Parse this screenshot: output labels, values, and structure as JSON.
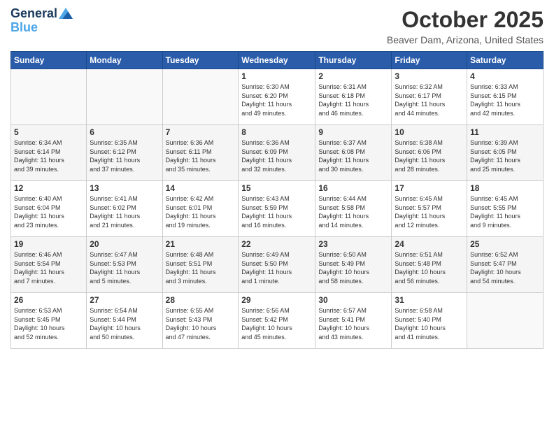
{
  "header": {
    "logo_line1": "General",
    "logo_line2": "Blue",
    "month_title": "October 2025",
    "location": "Beaver Dam, Arizona, United States"
  },
  "weekdays": [
    "Sunday",
    "Monday",
    "Tuesday",
    "Wednesday",
    "Thursday",
    "Friday",
    "Saturday"
  ],
  "weeks": [
    [
      {
        "day": "",
        "info": ""
      },
      {
        "day": "",
        "info": ""
      },
      {
        "day": "",
        "info": ""
      },
      {
        "day": "1",
        "info": "Sunrise: 6:30 AM\nSunset: 6:20 PM\nDaylight: 11 hours\nand 49 minutes."
      },
      {
        "day": "2",
        "info": "Sunrise: 6:31 AM\nSunset: 6:18 PM\nDaylight: 11 hours\nand 46 minutes."
      },
      {
        "day": "3",
        "info": "Sunrise: 6:32 AM\nSunset: 6:17 PM\nDaylight: 11 hours\nand 44 minutes."
      },
      {
        "day": "4",
        "info": "Sunrise: 6:33 AM\nSunset: 6:15 PM\nDaylight: 11 hours\nand 42 minutes."
      }
    ],
    [
      {
        "day": "5",
        "info": "Sunrise: 6:34 AM\nSunset: 6:14 PM\nDaylight: 11 hours\nand 39 minutes."
      },
      {
        "day": "6",
        "info": "Sunrise: 6:35 AM\nSunset: 6:12 PM\nDaylight: 11 hours\nand 37 minutes."
      },
      {
        "day": "7",
        "info": "Sunrise: 6:36 AM\nSunset: 6:11 PM\nDaylight: 11 hours\nand 35 minutes."
      },
      {
        "day": "8",
        "info": "Sunrise: 6:36 AM\nSunset: 6:09 PM\nDaylight: 11 hours\nand 32 minutes."
      },
      {
        "day": "9",
        "info": "Sunrise: 6:37 AM\nSunset: 6:08 PM\nDaylight: 11 hours\nand 30 minutes."
      },
      {
        "day": "10",
        "info": "Sunrise: 6:38 AM\nSunset: 6:06 PM\nDaylight: 11 hours\nand 28 minutes."
      },
      {
        "day": "11",
        "info": "Sunrise: 6:39 AM\nSunset: 6:05 PM\nDaylight: 11 hours\nand 25 minutes."
      }
    ],
    [
      {
        "day": "12",
        "info": "Sunrise: 6:40 AM\nSunset: 6:04 PM\nDaylight: 11 hours\nand 23 minutes."
      },
      {
        "day": "13",
        "info": "Sunrise: 6:41 AM\nSunset: 6:02 PM\nDaylight: 11 hours\nand 21 minutes."
      },
      {
        "day": "14",
        "info": "Sunrise: 6:42 AM\nSunset: 6:01 PM\nDaylight: 11 hours\nand 19 minutes."
      },
      {
        "day": "15",
        "info": "Sunrise: 6:43 AM\nSunset: 5:59 PM\nDaylight: 11 hours\nand 16 minutes."
      },
      {
        "day": "16",
        "info": "Sunrise: 6:44 AM\nSunset: 5:58 PM\nDaylight: 11 hours\nand 14 minutes."
      },
      {
        "day": "17",
        "info": "Sunrise: 6:45 AM\nSunset: 5:57 PM\nDaylight: 11 hours\nand 12 minutes."
      },
      {
        "day": "18",
        "info": "Sunrise: 6:45 AM\nSunset: 5:55 PM\nDaylight: 11 hours\nand 9 minutes."
      }
    ],
    [
      {
        "day": "19",
        "info": "Sunrise: 6:46 AM\nSunset: 5:54 PM\nDaylight: 11 hours\nand 7 minutes."
      },
      {
        "day": "20",
        "info": "Sunrise: 6:47 AM\nSunset: 5:53 PM\nDaylight: 11 hours\nand 5 minutes."
      },
      {
        "day": "21",
        "info": "Sunrise: 6:48 AM\nSunset: 5:51 PM\nDaylight: 11 hours\nand 3 minutes."
      },
      {
        "day": "22",
        "info": "Sunrise: 6:49 AM\nSunset: 5:50 PM\nDaylight: 11 hours\nand 1 minute."
      },
      {
        "day": "23",
        "info": "Sunrise: 6:50 AM\nSunset: 5:49 PM\nDaylight: 10 hours\nand 58 minutes."
      },
      {
        "day": "24",
        "info": "Sunrise: 6:51 AM\nSunset: 5:48 PM\nDaylight: 10 hours\nand 56 minutes."
      },
      {
        "day": "25",
        "info": "Sunrise: 6:52 AM\nSunset: 5:47 PM\nDaylight: 10 hours\nand 54 minutes."
      }
    ],
    [
      {
        "day": "26",
        "info": "Sunrise: 6:53 AM\nSunset: 5:45 PM\nDaylight: 10 hours\nand 52 minutes."
      },
      {
        "day": "27",
        "info": "Sunrise: 6:54 AM\nSunset: 5:44 PM\nDaylight: 10 hours\nand 50 minutes."
      },
      {
        "day": "28",
        "info": "Sunrise: 6:55 AM\nSunset: 5:43 PM\nDaylight: 10 hours\nand 47 minutes."
      },
      {
        "day": "29",
        "info": "Sunrise: 6:56 AM\nSunset: 5:42 PM\nDaylight: 10 hours\nand 45 minutes."
      },
      {
        "day": "30",
        "info": "Sunrise: 6:57 AM\nSunset: 5:41 PM\nDaylight: 10 hours\nand 43 minutes."
      },
      {
        "day": "31",
        "info": "Sunrise: 6:58 AM\nSunset: 5:40 PM\nDaylight: 10 hours\nand 41 minutes."
      },
      {
        "day": "",
        "info": ""
      }
    ]
  ]
}
